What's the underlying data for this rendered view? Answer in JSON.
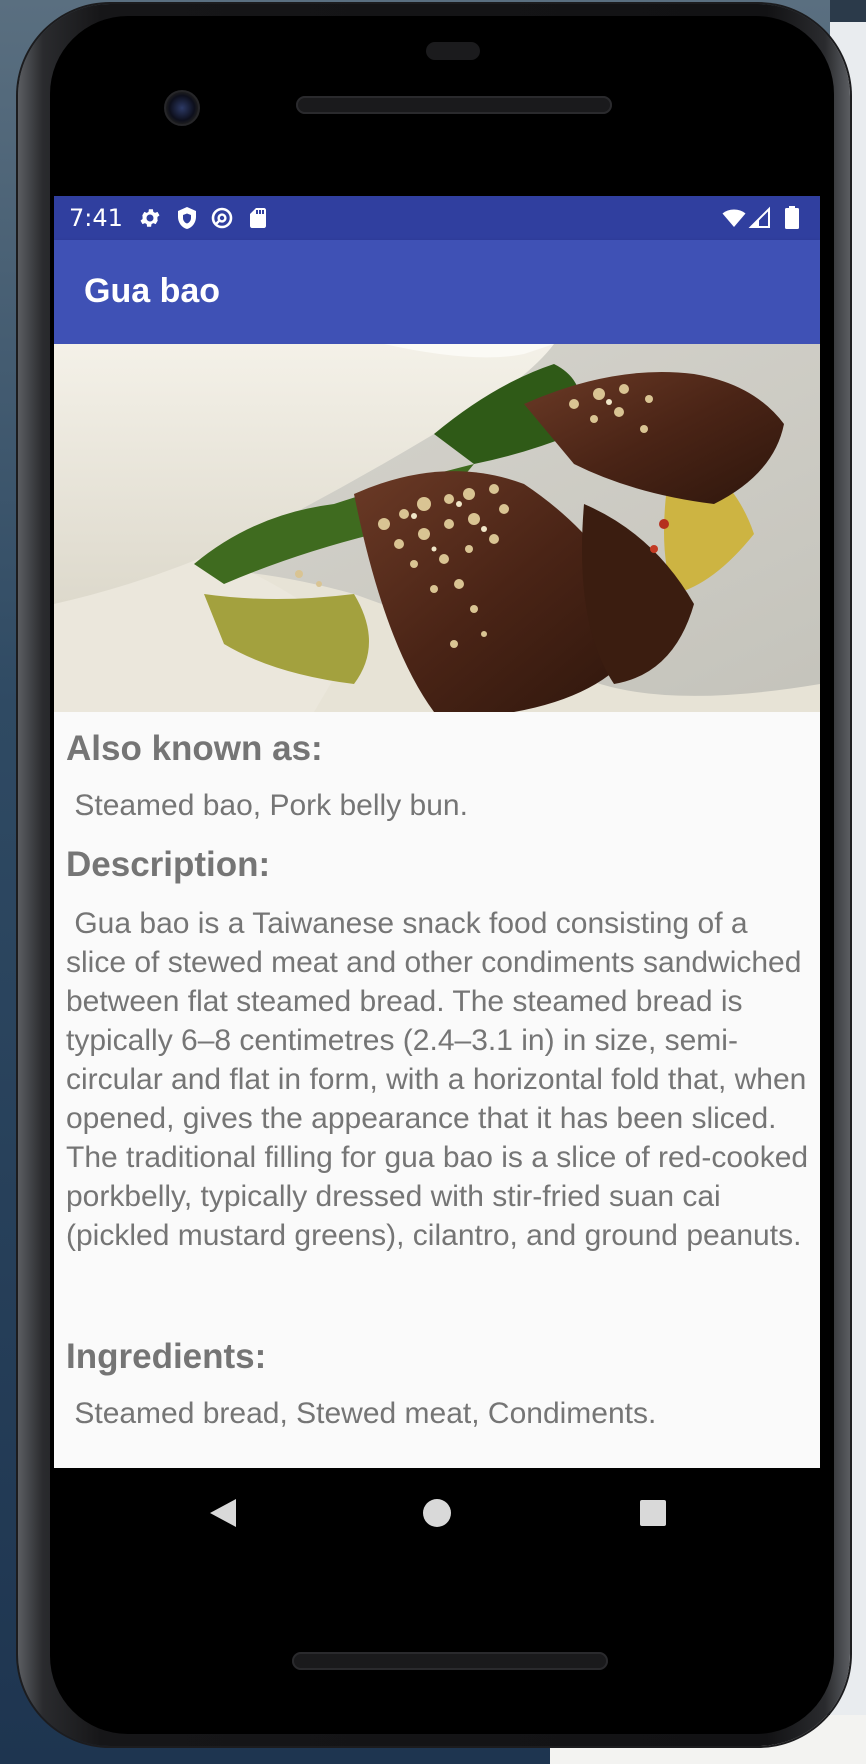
{
  "status_bar": {
    "time": "7:41",
    "left_icons": [
      "gear-icon",
      "shield-icon",
      "at-sign-icon",
      "sd-card-icon"
    ],
    "right_icons": [
      "wifi-icon",
      "signal-icon",
      "battery-icon"
    ],
    "color": "#303f9f"
  },
  "app_bar": {
    "title": "Gua bao",
    "color": "#3f51b5"
  },
  "image": {
    "subject": "food-photo"
  },
  "details": {
    "aka_heading": "Also known as:",
    "aka_value": " Steamed bao, Pork belly bun.",
    "description_heading": "Description:",
    "description_value": " Gua bao is a Taiwanese snack food consisting of a slice of stewed meat and other condiments sandwiched between flat steamed bread. The steamed bread is typically 6–8 centimetres (2.4–3.1 in) in size, semi-circular and flat in form, with a horizontal fold that, when opened, gives the appearance that it has been sliced. The traditional filling for gua bao is a slice of red-cooked porkbelly, typically dressed with stir-fried suan cai (pickled mustard greens), cilantro, and ground peanuts.",
    "ingredients_heading": "Ingredients:",
    "ingredients_value": " Steamed bread, Stewed meat, Condiments."
  },
  "nav_bar": {
    "buttons": [
      "back-icon",
      "home-icon",
      "recents-icon"
    ]
  },
  "colors": {
    "text_gray": "#757575",
    "screen_bg": "#fafafa"
  }
}
